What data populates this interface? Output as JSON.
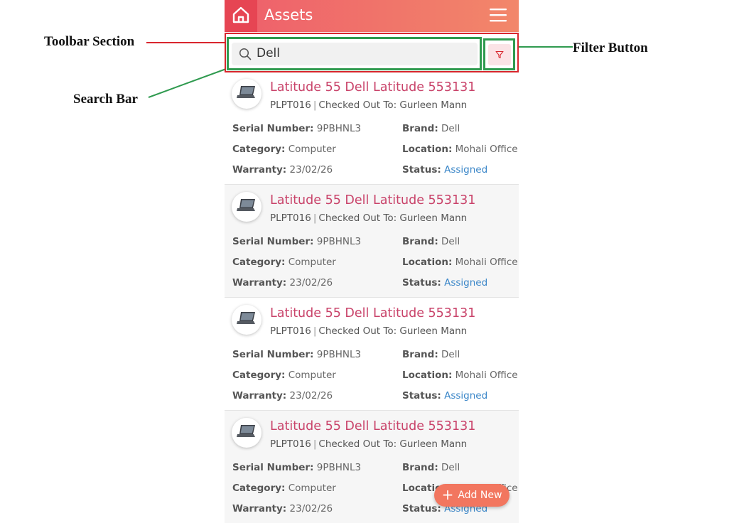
{
  "annotations": {
    "toolbar_section": "Toolbar Section",
    "filter_button": "Filter Button",
    "search_bar": "Search Bar"
  },
  "header": {
    "title": "Assets",
    "home_icon": "home-icon",
    "menu_icon": "hamburger-menu-icon"
  },
  "search": {
    "value": "Dell",
    "icon": "search-icon"
  },
  "filter": {
    "icon": "filter-icon"
  },
  "labels": {
    "serial": "Serial Number:",
    "brand": "Brand:",
    "category": "Category:",
    "location": "Location:",
    "warranty": "Warranty:",
    "status": "Status:"
  },
  "assets": [
    {
      "title": "Latitude 55 Dell Latitude 553131",
      "code": "PLPT016",
      "checked_out": "Checked Out To: Gurleen Mann",
      "serial": "9PBHNL3",
      "brand": "Dell",
      "category": "Computer",
      "location": "Mohali Office",
      "warranty": "23/02/26",
      "status": "Assigned"
    },
    {
      "title": "Latitude 55 Dell Latitude 553131",
      "code": "PLPT016",
      "checked_out": "Checked Out To: Gurleen Mann",
      "serial": "9PBHNL3",
      "brand": "Dell",
      "category": "Computer",
      "location": "Mohali Office",
      "warranty": "23/02/26",
      "status": "Assigned"
    },
    {
      "title": "Latitude 55 Dell Latitude 553131",
      "code": "PLPT016",
      "checked_out": "Checked Out To: Gurleen Mann",
      "serial": "9PBHNL3",
      "brand": "Dell",
      "category": "Computer",
      "location": "Mohali Office",
      "warranty": "23/02/26",
      "status": "Assigned"
    },
    {
      "title": "Latitude 55 Dell Latitude 553131",
      "code": "PLPT016",
      "checked_out": "Checked Out To: Gurleen Mann",
      "serial": "9PBHNL3",
      "brand": "Dell",
      "category": "Computer",
      "location": "Mohali Office",
      "warranty": "23/02/26",
      "status": "Assigned"
    }
  ],
  "fab": {
    "label": "Add New",
    "icon": "plus-icon"
  },
  "colors": {
    "accent": "#e64553",
    "title": "#c9436a",
    "status": "#3a86c8",
    "annotation_red": "#d9262e",
    "annotation_green": "#2f9a4f"
  }
}
